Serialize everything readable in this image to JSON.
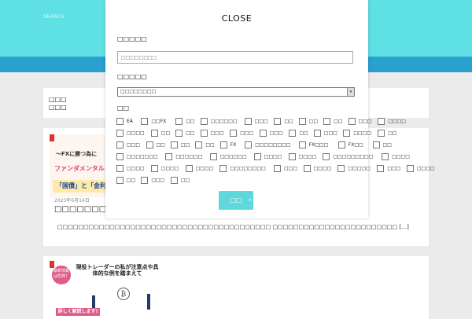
{
  "header": {
    "search_label": "SEARCH"
  },
  "sidebar_card": {
    "line1": "□□□",
    "line2": "□□□"
  },
  "post1": {
    "thumb_line1": "～FXに勝つ為に",
    "thumb_line2": "ファンダメンタル",
    "thumb_line3": "「国債」と「金利」の",
    "date": "2023年6月14日",
    "title": "□□□□□□□□□□□□□",
    "excerpt": "□□□□□□□□□□□□□□□□□□□□□□□□□□□□□□□□□□□□□□□□□ □□□□□□□□□□□□□□□□□□□□□□□□ […]"
  },
  "post2": {
    "badge": "最新情報は危険？",
    "headline": "現役トレーダーの私が注意点や具体的な例を踏まえて",
    "coin": "₿",
    "tag": "詳しく解説します!"
  },
  "modal": {
    "close_label": "CLOSE",
    "keyword_label": "□□□□□",
    "keyword_placeholder": "□□□□□□□□",
    "category_label": "□□□□□",
    "category_selected": "□□□□□□□□",
    "tags_label": "□□",
    "tags": [
      [
        "EA",
        "□□FX",
        "□□",
        "□□□□□□",
        "□□□",
        "□□",
        "□□",
        "□□",
        "□□□",
        "□□□□"
      ],
      [
        "□□□□",
        "□□",
        "□□",
        "□□□",
        "□□□",
        "□□□",
        "□□",
        "□□□",
        "□□□□",
        "□□"
      ],
      [
        "□□□",
        "□□",
        "□□",
        "□□",
        "FX",
        "□□□□□□□□",
        "FX□□□",
        "FX□□",
        "□□"
      ],
      [
        "□□□□□□□",
        "□□□□□□",
        "□□□□□□",
        "□□□□",
        "□□□□",
        "□□□□□□□□□",
        "□□□□"
      ],
      [
        "□□□□",
        "□□□□",
        "□□□□",
        "□□□□□□□□",
        "□□□",
        "□□□□",
        "□□□□□",
        "□□□",
        "□□□□"
      ],
      [
        "□□",
        "□□□",
        "□□"
      ]
    ],
    "submit_label": "□□",
    "submit_dropdown": "▾"
  }
}
